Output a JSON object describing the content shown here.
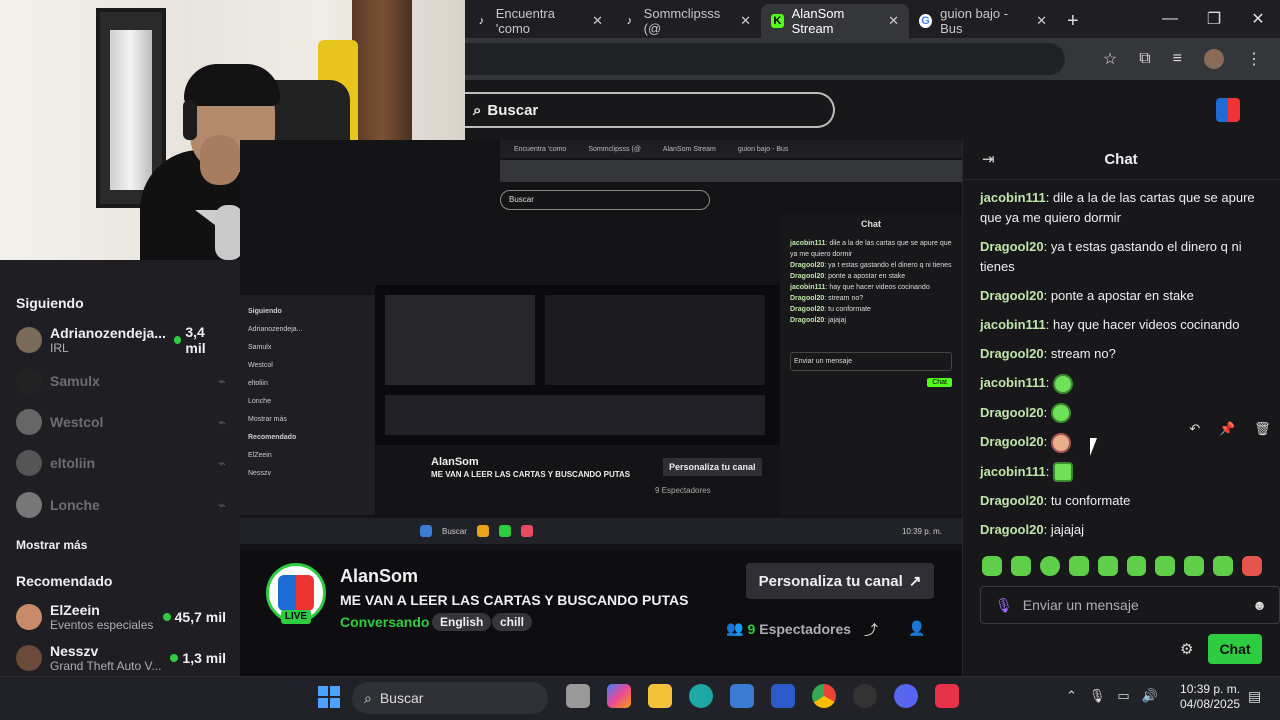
{
  "browser": {
    "tabs": [
      {
        "label": "Encuentra 'como",
        "icon": "tiktok-icon"
      },
      {
        "label": "Sommclipsss (@",
        "icon": "tiktok-icon"
      },
      {
        "label": "AlanSom Stream",
        "icon": "kick-icon",
        "active": true
      },
      {
        "label": "guion bajo - Bus",
        "icon": "google-icon"
      }
    ]
  },
  "site": {
    "search_placeholder": "Buscar"
  },
  "sidebar": {
    "following_title": "Siguiendo",
    "following": [
      {
        "name": "Adrianozendeja...",
        "sub": "IRL",
        "viewers": "3,4 mil",
        "live": true
      },
      {
        "name": "Samulx",
        "live": false
      },
      {
        "name": "Westcol",
        "live": false
      },
      {
        "name": "eltoliin",
        "live": false
      },
      {
        "name": "Lonche",
        "live": false
      }
    ],
    "show_more": "Mostrar más",
    "recommended_title": "Recomendado",
    "recommended": [
      {
        "name": "ElZeein",
        "sub": "Eventos especiales",
        "viewers": "45,7 mil"
      },
      {
        "name": "Nesszv",
        "sub": "Grand Theft Auto V...",
        "viewers": "1,3 mil"
      }
    ]
  },
  "stream": {
    "channel": "AlanSom",
    "title": "ME VAN A LEER LAS CARTAS Y BUSCANDO PUTAS",
    "category": "Conversando",
    "tags": [
      "English",
      "chill"
    ],
    "live_label": "LIVE",
    "customize_label": "Personaliza tu canal",
    "viewers": "9",
    "viewers_label": "Espectadores"
  },
  "chat": {
    "title": "Chat",
    "messages": [
      {
        "user": "jacobin111",
        "text": "dile a la de las cartas que se apure que ya me quiero dormir"
      },
      {
        "user": "Dragool20",
        "text": "ya t estas gastando el dinero q ni tienes"
      },
      {
        "user": "Dragool20",
        "text": "ponte a apostar en stake"
      },
      {
        "user": "jacobin111",
        "text": "hay que hacer videos cocinando"
      },
      {
        "user": "Dragool20",
        "text": "stream no?"
      },
      {
        "user": "jacobin111",
        "text": "",
        "emote": true
      },
      {
        "user": "Dragool20",
        "text": "",
        "emote": true
      },
      {
        "user": "Dragool20",
        "text": "",
        "emote": true
      },
      {
        "user": "jacobin111",
        "text": "",
        "emote": true
      },
      {
        "user": "Dragool20",
        "text": "tu conformate"
      },
      {
        "user": "Dragool20",
        "text": "jajajaj"
      }
    ],
    "input_placeholder": "Enviar un mensaje",
    "send_label": "Chat"
  },
  "inner": {
    "chat_title": "Chat",
    "search": "Buscar",
    "following": "Siguiendo",
    "show_more": "Mostrar más",
    "recommended": "Recomendado",
    "channel": "AlanSom",
    "title": "ME VAN A LEER LAS CARTAS Y BUSCANDO PUTAS",
    "customize": "Personaliza tu canal",
    "viewers": "9 Espectadores",
    "send": "Chat",
    "input": "Enviar un mensaje"
  },
  "taskbar": {
    "search": "Buscar",
    "time": "10:39 p. m.",
    "date": "04/08/2025"
  },
  "colors": {
    "accent": "#53fc18",
    "background": "#0e0e10",
    "username": "#bfe5a8"
  }
}
